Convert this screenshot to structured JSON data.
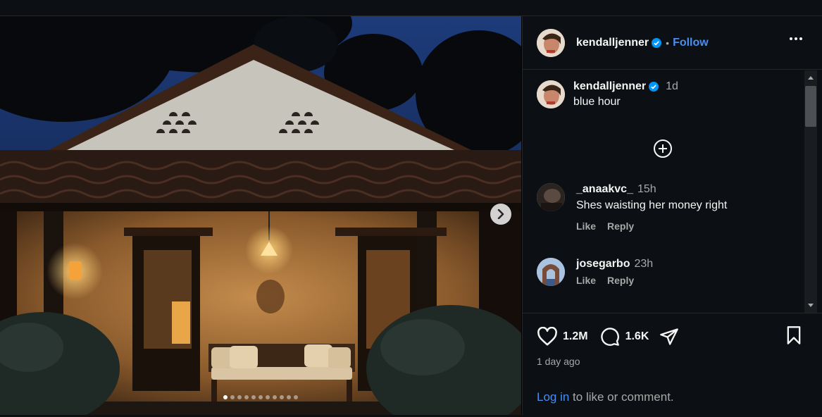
{
  "post": {
    "author": "kendalljenner",
    "follow_label": "Follow",
    "separator": "•",
    "caption": "blue hour",
    "caption_time": "1d",
    "slide_count": 11,
    "active_slide": 0
  },
  "comments": [
    {
      "user": "_anaakvc_",
      "time": "15h",
      "text": "Shes waisting her money right",
      "like": "Like",
      "reply": "Reply"
    },
    {
      "user": "josegarbo",
      "time": "23h",
      "text": "",
      "like": "Like",
      "reply": "Reply"
    }
  ],
  "footer": {
    "likes": "1.2M",
    "comments": "1.6K",
    "age": "1 day ago",
    "login_link": "Log in",
    "login_rest": " to like or comment."
  },
  "colors": {
    "background": "#0c1014",
    "link": "#4a8ef0",
    "verified": "#0095f6",
    "muted": "#a8a8a8"
  },
  "icons": [
    "chevron-right-icon",
    "more-options-icon",
    "verified-badge-icon",
    "load-more-plus-icon",
    "heart-icon",
    "comment-icon",
    "share-icon",
    "bookmark-icon"
  ]
}
